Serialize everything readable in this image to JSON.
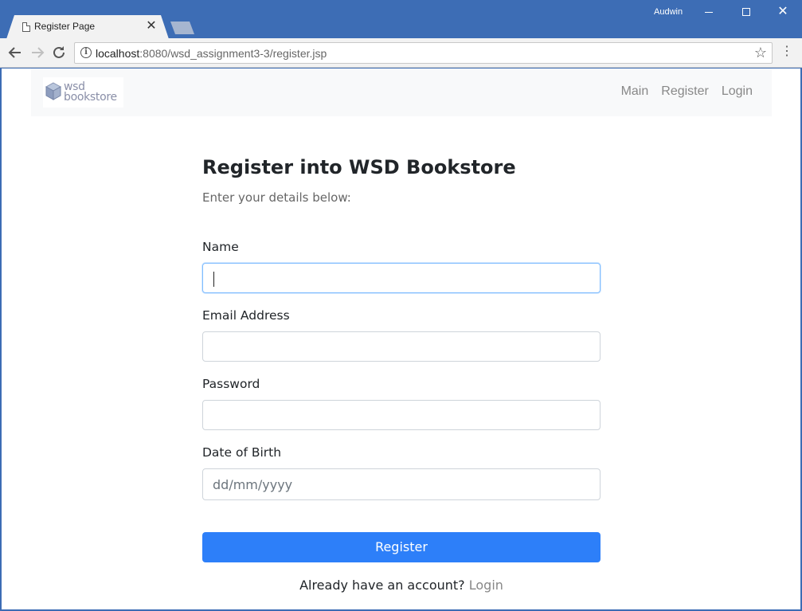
{
  "browser": {
    "tab_title": "Register Page",
    "close_glyph": "✕",
    "user_name": "Audwin",
    "url_host": "localhost",
    "url_path": ":8080/wsd_assignment3-3/register.jsp"
  },
  "navbar": {
    "logo_line1": "wsd",
    "logo_line2": "bookstore",
    "links": [
      "Main",
      "Register",
      "Login"
    ]
  },
  "form": {
    "heading": "Register into WSD Bookstore",
    "subheading": "Enter your details below:",
    "fields": [
      {
        "label": "Name",
        "value": "",
        "placeholder": ""
      },
      {
        "label": "Email Address",
        "value": "",
        "placeholder": ""
      },
      {
        "label": "Password",
        "value": "",
        "placeholder": ""
      },
      {
        "label": "Date of Birth",
        "value": "",
        "placeholder": "dd/mm/yyyy"
      }
    ],
    "submit_label": "Register",
    "footer_text": "Already have an account?",
    "footer_link": "Login"
  },
  "colors": {
    "titlebar": "#3d6db5",
    "primary_button": "#2d7ff9",
    "navbar_bg": "#f8f9fa"
  },
  "icons": [
    "page-icon",
    "back-arrow-icon",
    "forward-arrow-icon",
    "reload-icon",
    "info-icon",
    "star-icon",
    "menu-dots-icon",
    "minimize-icon",
    "maximize-icon",
    "close-icon"
  ]
}
